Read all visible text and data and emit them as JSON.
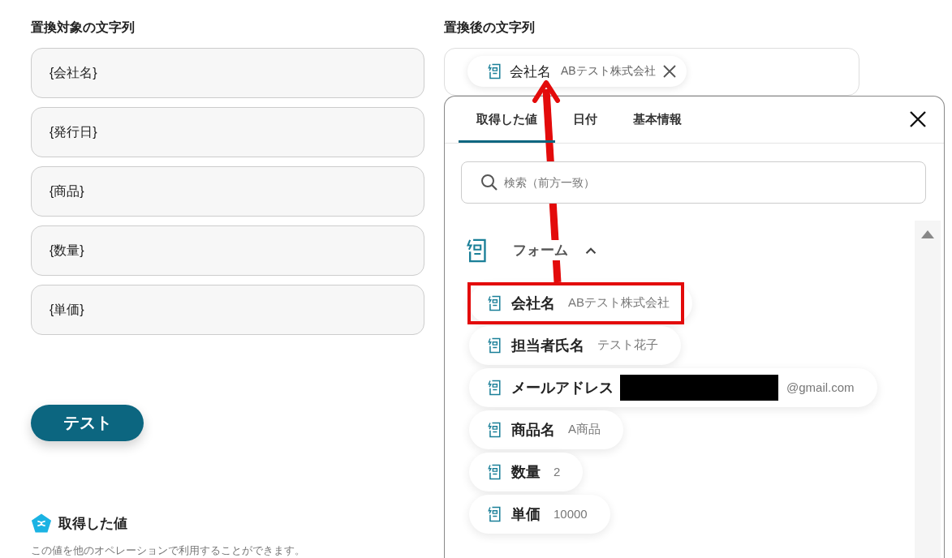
{
  "left": {
    "label": "置換対象の文字列",
    "fields": [
      {
        "value": "{会社名}"
      },
      {
        "value": "{発行日}"
      },
      {
        "value": "{商品}"
      },
      {
        "value": "{数量}"
      },
      {
        "value": "{単価}"
      }
    ],
    "button": "テスト",
    "section": {
      "title": "取得した値",
      "description": "この値を他のオペレーションで利用することができます。"
    }
  },
  "right": {
    "label": "置換後の文字列",
    "chip": {
      "name": "会社名",
      "value": "ABテスト株式会社"
    },
    "panel": {
      "tabs": [
        {
          "label": "取得した値",
          "selected": true
        },
        {
          "label": "日付",
          "selected": false
        },
        {
          "label": "基本情報",
          "selected": false
        }
      ],
      "search": {
        "placeholder": "検索（前方一致）"
      },
      "group": {
        "title": "フォーム",
        "expanded": true,
        "items": [
          {
            "name": "会社名",
            "value": "ABテスト株式会社",
            "highlighted": true,
            "redacted": false
          },
          {
            "name": "担当者氏名",
            "value": "テスト花子",
            "highlighted": false,
            "redacted": false
          },
          {
            "name": "メールアドレス",
            "value": "@gmail.com",
            "highlighted": false,
            "redacted": true
          },
          {
            "name": "商品名",
            "value": "A商品",
            "highlighted": false,
            "redacted": false
          },
          {
            "name": "数量",
            "value": "2",
            "highlighted": false,
            "redacted": false
          },
          {
            "name": "単価",
            "value": "10000",
            "highlighted": false,
            "redacted": false
          }
        ]
      }
    }
  }
}
